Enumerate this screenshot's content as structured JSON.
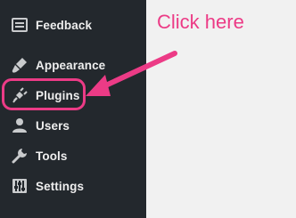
{
  "sidebar": {
    "items": [
      {
        "key": "feedback",
        "label": "Feedback",
        "icon": "feedback-icon"
      },
      {
        "key": "appearance",
        "label": "Appearance",
        "icon": "paintbrush-icon"
      },
      {
        "key": "plugins",
        "label": "Plugins",
        "icon": "plug-icon"
      },
      {
        "key": "users",
        "label": "Users",
        "icon": "user-icon"
      },
      {
        "key": "tools",
        "label": "Tools",
        "icon": "wrench-icon"
      },
      {
        "key": "settings",
        "label": "Settings",
        "icon": "sliders-icon"
      }
    ]
  },
  "annotation": {
    "text": "Click here",
    "color": "#ec3b86"
  },
  "colors": {
    "sidebar_bg": "#23282d",
    "menu_text": "#eeeeee",
    "content_bg": "#f1f1f1"
  }
}
